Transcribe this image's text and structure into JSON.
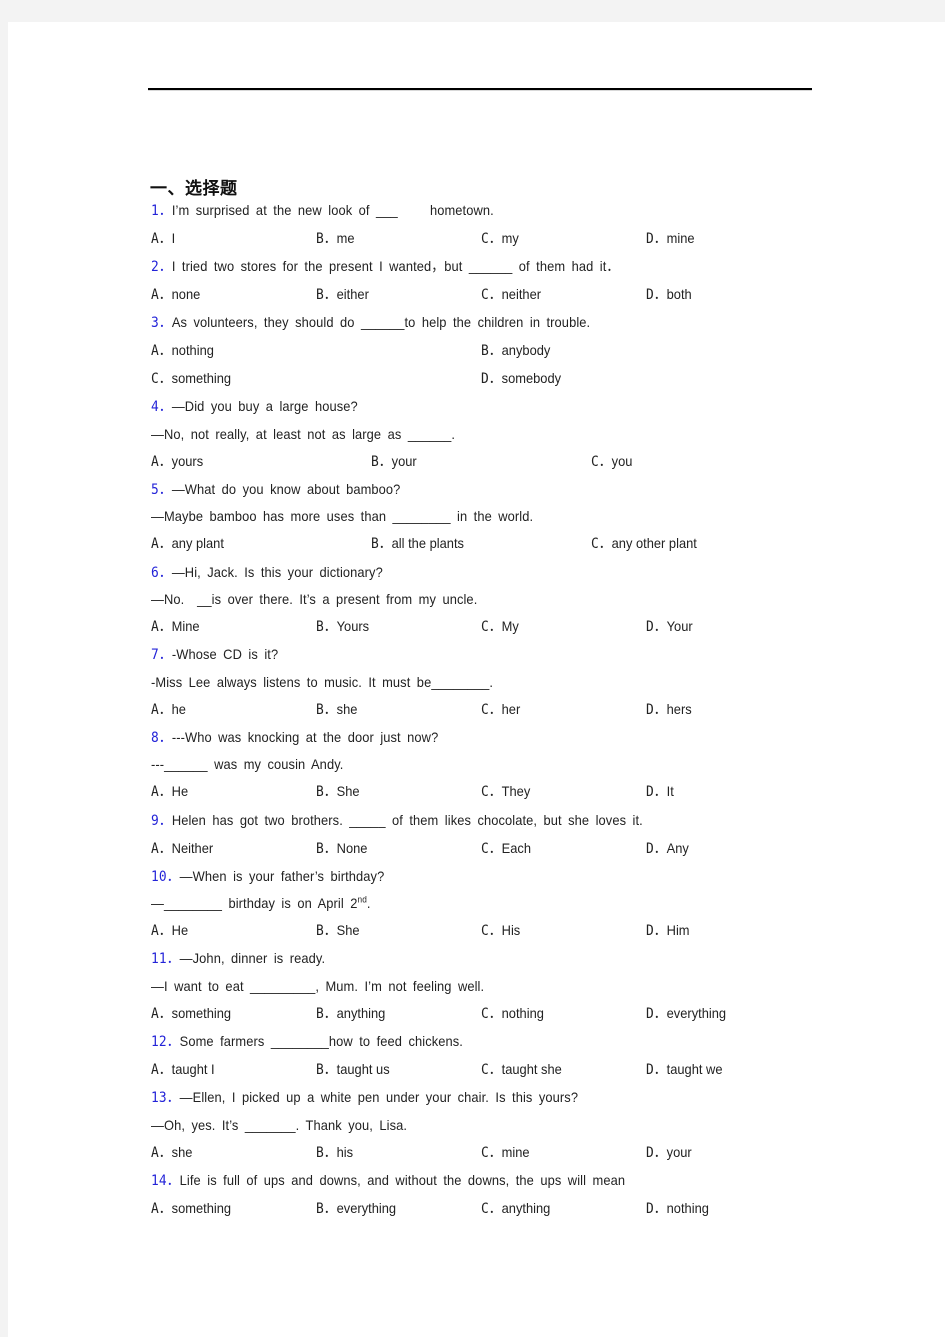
{
  "section": {
    "title": "一、选择题"
  },
  "questions": [
    {
      "num": "1．",
      "stem": [
        "I’m surprised at the new look of ___     hometown."
      ],
      "options": [
        [
          "A．",
          "I"
        ],
        [
          "B．",
          "me"
        ],
        [
          "C．",
          "my"
        ],
        [
          "D．",
          "mine"
        ]
      ]
    },
    {
      "num": "2．",
      "stem": [
        "I tried two stores for the present I wanted，but ______ of them had it．"
      ],
      "options": [
        [
          "A．",
          "none"
        ],
        [
          "B．",
          "either"
        ],
        [
          "C．",
          "neither"
        ],
        [
          "D．",
          "both"
        ]
      ]
    },
    {
      "num": "3．",
      "stem": [
        "As volunteers, they should do ______to help the children in trouble."
      ],
      "options": [
        [
          "A．",
          "nothing"
        ],
        [
          "B．",
          "anybody"
        ],
        [
          "C．",
          "something"
        ],
        [
          "D．",
          "somebody"
        ]
      ]
    },
    {
      "num": "4．",
      "stem": [
        "—Did you buy a large house?",
        "—No, not really, at least not as large as ______."
      ],
      "options": [
        [
          "A．",
          "yours"
        ],
        [
          "B．",
          "your"
        ],
        [
          "C．",
          "you"
        ]
      ]
    },
    {
      "num": "5．",
      "stem": [
        "—What do you know about bamboo?",
        "—Maybe bamboo has more uses than ________ in the world."
      ],
      "options": [
        [
          "A．",
          "any plant"
        ],
        [
          "B．",
          "all the plants"
        ],
        [
          "C．",
          "any other plant"
        ]
      ]
    },
    {
      "num": "6．",
      "stem": [
        "—Hi, Jack. Is this your dictionary?",
        "—No.  __is over there. It’s a present from my uncle."
      ],
      "options": [
        [
          "A．",
          "Mine"
        ],
        [
          "B．",
          "Yours"
        ],
        [
          "C．",
          "My"
        ],
        [
          "D．",
          "Your"
        ]
      ]
    },
    {
      "num": "7．",
      "stem": [
        "-Whose CD is it?",
        "-Miss Lee always listens to music. It must be________."
      ],
      "options": [
        [
          "A．",
          "he"
        ],
        [
          "B．",
          "she"
        ],
        [
          "C．",
          "her"
        ],
        [
          "D．",
          "hers"
        ]
      ]
    },
    {
      "num": "8．",
      "stem": [
        "---Who was knocking at the door just now?",
        "---______ was my cousin Andy."
      ],
      "options": [
        [
          "A．",
          "He"
        ],
        [
          "B．",
          "She"
        ],
        [
          "C．",
          "They"
        ],
        [
          "D．",
          "It"
        ]
      ]
    },
    {
      "num": "9．",
      "stem": [
        "Helen has got two brothers. _____ of them likes chocolate, but she loves it."
      ],
      "options": [
        [
          "A．",
          "Neither"
        ],
        [
          "B．",
          "None"
        ],
        [
          "C．",
          "Each"
        ],
        [
          "D．",
          "Any"
        ]
      ]
    },
    {
      "num": "10．",
      "stem": [
        "—When is your father’s birthday?",
        "—________ birthday is on April 2"
      ],
      "stem_sup": "nd",
      "stem_tail": ".",
      "options": [
        [
          "A．",
          "He"
        ],
        [
          "B．",
          "She"
        ],
        [
          "C．",
          "His"
        ],
        [
          "D．",
          "Him"
        ]
      ]
    },
    {
      "num": "11．",
      "stem": [
        "—John, dinner is ready.",
        "—I want to eat _________, Mum. I’m not feeling well."
      ],
      "options": [
        [
          "A．",
          "something"
        ],
        [
          "B．",
          "anything"
        ],
        [
          "C．",
          "nothing"
        ],
        [
          "D．",
          "everything"
        ]
      ]
    },
    {
      "num": "12．",
      "stem": [
        "Some farmers ________how to feed chickens."
      ],
      "options": [
        [
          "A．",
          "taught I"
        ],
        [
          "B．",
          "taught us"
        ],
        [
          "C．",
          "taught she"
        ],
        [
          "D．",
          "taught we"
        ]
      ]
    },
    {
      "num": "13．",
      "stem": [
        "—Ellen, I picked up a white pen under your chair. Is this yours?",
        "—Oh, yes. It’s _______. Thank you, Lisa."
      ],
      "options": [
        [
          "A．",
          "she"
        ],
        [
          "B．",
          "his"
        ],
        [
          "C．",
          "mine"
        ],
        [
          "D．",
          "your"
        ]
      ]
    },
    {
      "num": "14．",
      "stem": [
        "Life is full of ups and downs, and without the downs, the ups will mean"
      ],
      "options": [
        [
          "A．",
          "something"
        ],
        [
          "B．",
          "everything"
        ],
        [
          "C．",
          "anything"
        ],
        [
          "D．",
          "nothing"
        ]
      ]
    }
  ]
}
